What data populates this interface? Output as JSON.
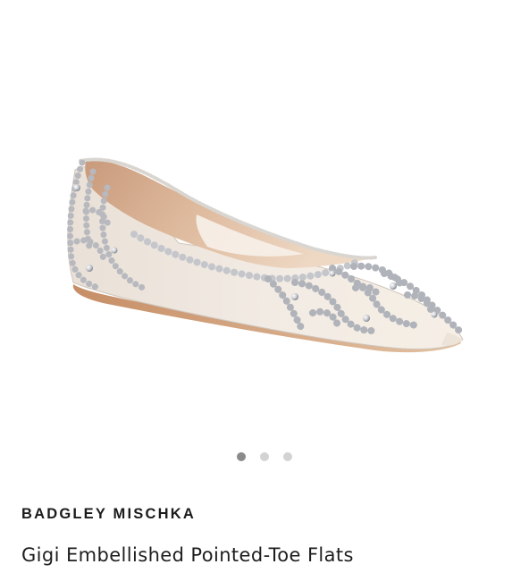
{
  "product": {
    "brand": "BADGLEY MISCHKA",
    "name": "Gigi Embellished Pointed-Toe Flats",
    "image_icon": "embellished-flat-shoe-photo"
  },
  "gallery": {
    "image_count": 3,
    "active_index": 0,
    "dots": [
      "image-1",
      "image-2",
      "image-3"
    ]
  },
  "colors": {
    "background": "#ffffff",
    "dot_active": "#8b8b8b",
    "dot_inactive": "#d3d3d3",
    "text": "#1b1b1b"
  }
}
